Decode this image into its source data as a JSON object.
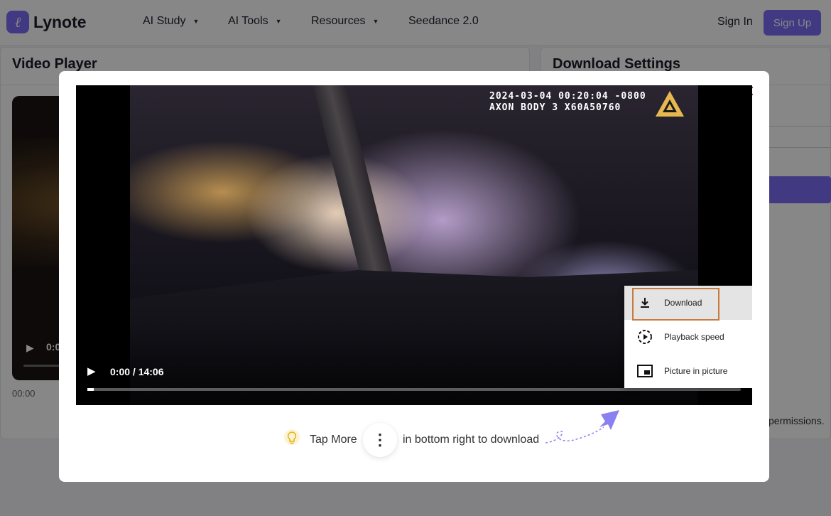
{
  "nav": {
    "brand": "Lynote",
    "items": [
      {
        "label": "AI Study",
        "has_caret": true
      },
      {
        "label": "AI Tools",
        "has_caret": true
      },
      {
        "label": "Resources",
        "has_caret": true
      },
      {
        "label": "Seedance 2.0",
        "has_caret": false
      }
    ],
    "sign_in": "Sign In",
    "sign_up": "Sign Up"
  },
  "left_panel": {
    "title": "Video Player",
    "time_short": "0:0",
    "timestamp": "00:00"
  },
  "right_panel": {
    "title": "Download Settings",
    "permissions_text": "permissions."
  },
  "modal": {
    "close_icon": "close-icon",
    "video": {
      "osd_line1": "2024-03-04 00:20:04 -0800",
      "osd_line2": "AXON BODY 3 X60A50760",
      "time": "0:00 / 14:06",
      "progress_fraction": 0.0
    },
    "context_menu": {
      "items": [
        {
          "label": "Download",
          "icon": "download-icon",
          "highlighted": true
        },
        {
          "label": "Playback speed",
          "icon": "playback-speed-icon",
          "highlighted": false
        },
        {
          "label": "Picture in picture",
          "icon": "picture-in-picture-icon",
          "highlighted": false
        }
      ]
    },
    "tip": {
      "before": "Tap More",
      "after": "in bottom right to download"
    }
  },
  "colors": {
    "accent": "#7b6cf5",
    "highlight_border": "#c97a3e",
    "close_icon": "#7a2a3a"
  }
}
